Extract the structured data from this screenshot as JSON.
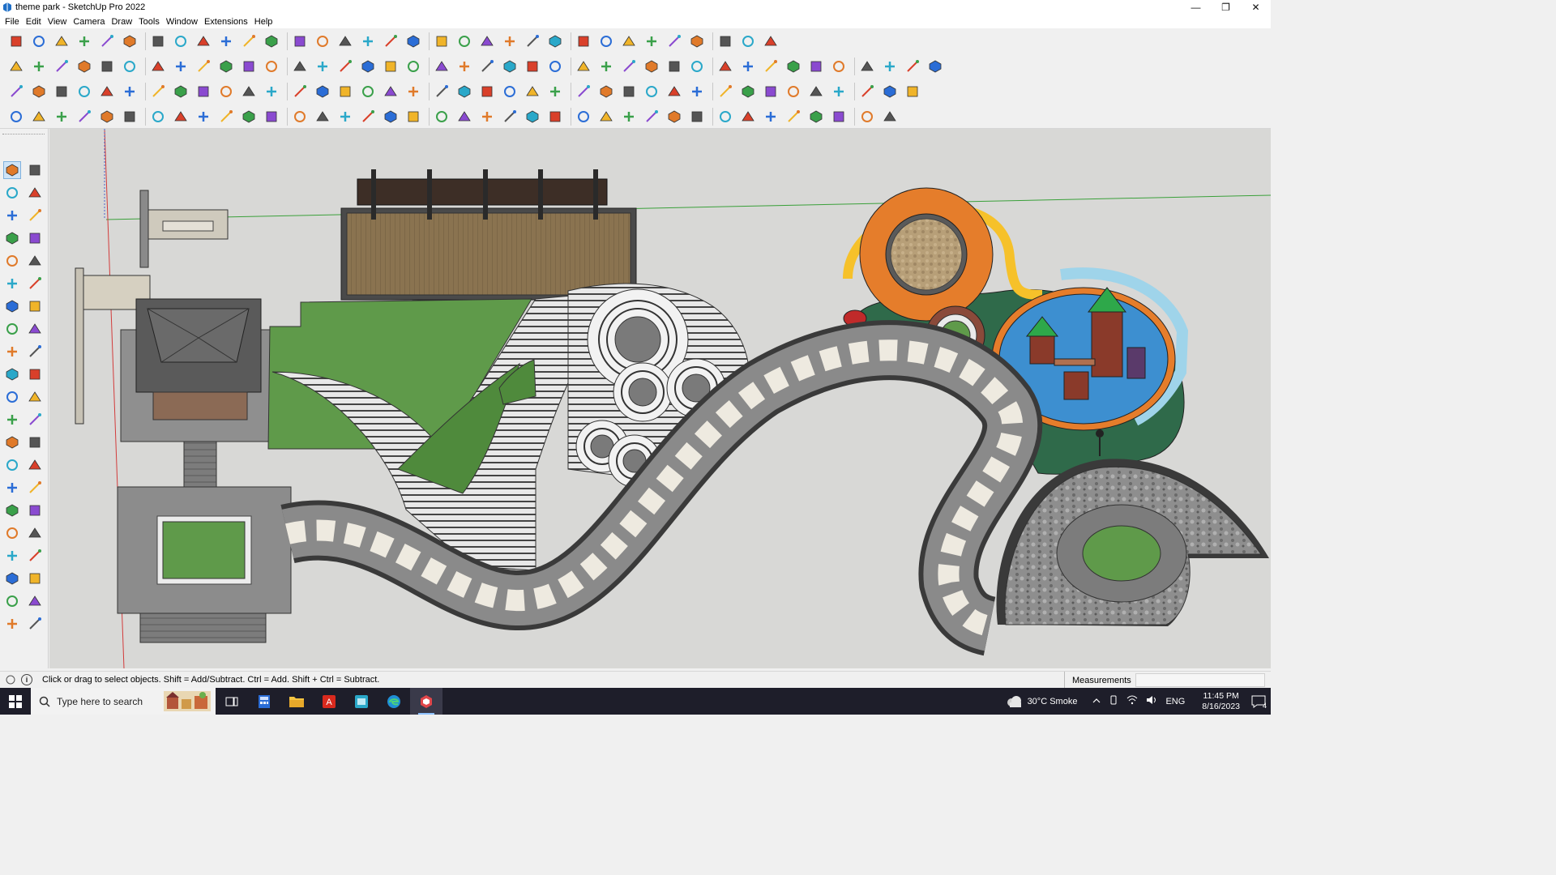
{
  "window": {
    "title": "theme park - SketchUp Pro 2022",
    "minimize_glyph": "—",
    "restore_glyph": "❐",
    "close_glyph": "✕"
  },
  "menu": [
    "File",
    "Edit",
    "View",
    "Camera",
    "Draw",
    "Tools",
    "Window",
    "Extensions",
    "Help"
  ],
  "status": {
    "hint": "Click or drag to select objects. Shift = Add/Subtract. Ctrl = Add. Shift + Ctrl = Subtract.",
    "measurements_label": "Measurements",
    "measurements_value": ""
  },
  "taskbar": {
    "search_placeholder": "Type here to search",
    "weather": "30°C  Smoke",
    "language": "ENG",
    "time": "11:45 PM",
    "date": "8/16/2023",
    "notification_count": "4"
  },
  "colors": {
    "sky": "#d8d8d6",
    "grass": "#5f9a4a",
    "dark_green": "#2f6a4a",
    "deck": "#8a7350",
    "stone": "#8b8b8b",
    "pool": "#3d8fd0",
    "orange": "#e57d2b",
    "yellow": "#f6c12a"
  },
  "icons": {
    "toolbar_row1": [
      "zoom-icon",
      "select-icon",
      "eraser-icon",
      "pencil-icon",
      "lasso-icon",
      "paint-icon",
      "push-pull-icon",
      "follow-me-icon",
      "move-icon",
      "rotate-icon",
      "scale-icon",
      "tape-icon",
      "text-icon",
      "paint-bucket-icon",
      "orbit-icon",
      "pan-icon",
      "zoom-window-icon",
      "zoom-extents-icon",
      "section-icon",
      "layers-icon",
      "outliner-icon",
      "component-icon",
      "warehouse-icon",
      "extension-icon",
      "style-icon",
      "scene-icon",
      "arrows-up-icon",
      "arrows-down-icon",
      "dimension-icon",
      "protractor-icon",
      "undo-icon",
      "redo-icon",
      "sandbox-icon"
    ],
    "toolbar_row2": [
      "cube-yellow-icon",
      "cube-glass-icon",
      "cube-shaded-icon",
      "push-red-icon",
      "vertical-arrows-icon",
      "solid-tools-icon",
      "union-icon",
      "subtract-icon",
      "trim-icon",
      "split-icon",
      "smooth-icon",
      "plane-icon",
      "section-plane-icon",
      "flip-icon",
      "terrain-icon",
      "house-icon",
      "window-icon",
      "door-icon",
      "roof-icon",
      "stairs-icon",
      "font-icon",
      "tag-icon",
      "marker-icon",
      "ring-icon",
      "circle-icon",
      "polygon-icon",
      "ellipse-icon",
      "parallelogram-icon",
      "curve-icon",
      "bezier-icon",
      "bulge-icon",
      "offset-icon",
      "arrow-red-icon",
      "pink-eraser-icon",
      "shape-1-icon",
      "shape-2-icon",
      "shape-3-icon",
      "shape-4-icon",
      "shape-5-icon",
      "shape-6-icon"
    ],
    "toolbar_row3": [
      "blue-plane-icon",
      "blue-plane-2-icon",
      "yellow-plane-icon",
      "text-label-icon",
      "red-arrow-icon",
      "wire-icon",
      "orange-arc-icon",
      "red-square-icon",
      "grid-icon",
      "page-icon",
      "wood-icon",
      "link-icon",
      "hook-icon",
      "dots-icon",
      "red-cross-icon",
      "green-cross-icon",
      "blue-cross-icon",
      "blue-cone-icon",
      "blue-mountain-icon",
      "warning-icon",
      "orange-ring-icon",
      "orange-scissors-icon",
      "cycle-icon",
      "blue-star-icon",
      "box-icon",
      "magnet-icon",
      "green-blocks-icon",
      "frames-icon",
      "boxes-icon",
      "red-figure-icon",
      "red-hex-icon",
      "tool-x-icon",
      "screen-icon",
      "wall-icon",
      "window-2-icon",
      "grid-2-icon",
      "x-icon",
      "circle-dots-icon",
      "pattern-icon"
    ],
    "toolbar_row4": [
      "rect-node-icon",
      "polyline-icon",
      "spray-icon",
      "cylinder-icon",
      "line-icon",
      "cross-section-icon",
      "claw-icon",
      "bowl-icon",
      "hose-icon",
      "fork-icon",
      "angle-icon",
      "slope-icon",
      "arrow-line-icon",
      "arc-red-icon",
      "bridge-icon",
      "sail-icon",
      "rail-icon",
      "gate-icon",
      "hand-icon",
      "leaf-icon",
      "arrow-left-icon",
      "stack-icon",
      "slash-icon",
      "fan-icon",
      "fan-2-icon",
      "fan-3-icon",
      "building-icon",
      "ramp-icon",
      "column-icon",
      "wall-2-icon",
      "mesh-icon",
      "lines-icon",
      "bars-icon",
      "drum-icon",
      "spiral-icon",
      "zigzag-icon",
      "hatch-icon",
      "house-2-icon"
    ],
    "left_palette": [
      "select-tool-icon",
      "orbit-tool-icon",
      "paint-tool-icon",
      "eraser-tool-icon",
      "warehouse-tool-icon",
      "tape-tool-icon",
      "line-tool-icon",
      "freehand-tool-icon",
      "rectangle-tool-icon",
      "rotated-rect-icon",
      "circle-tool-icon",
      "polygon-tool-icon",
      "arc-tool-icon",
      "two-point-arc-icon",
      "three-point-arc-icon",
      "pie-tool-icon",
      "move-tool-icon",
      "push-pull-tool-icon",
      "rotate-tool-icon",
      "follow-me-tool-icon",
      "scale-tool-icon",
      "offset-tool-icon",
      "tape-measure-icon",
      "dimension-tool-icon",
      "protractor-tool-icon",
      "text-tool-icon",
      "axes-tool-icon",
      "3d-text-icon",
      "orbit-2-icon",
      "pan-tool-icon",
      "zoom-tool-icon",
      "zoom-window-tool-icon",
      "zoom-extents-tool-icon",
      "previous-view-icon",
      "position-camera-icon",
      "look-around-icon",
      "walk-tool-icon",
      "section-tool-icon",
      "layers-tool-icon",
      "styles-tool-icon",
      "scenes-tool-icon",
      "entity-info-icon"
    ]
  }
}
